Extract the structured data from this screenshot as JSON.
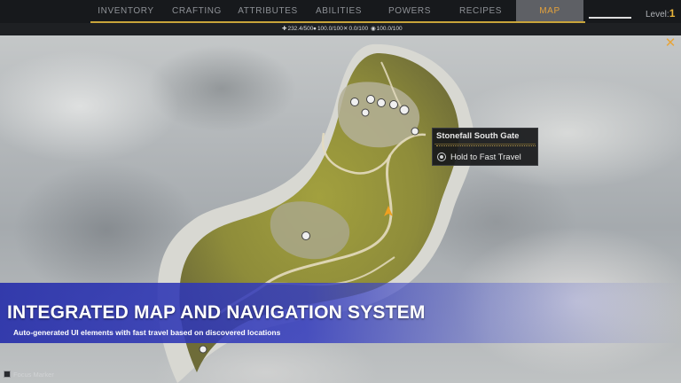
{
  "nav": {
    "tabs": [
      {
        "label": "INVENTORY"
      },
      {
        "label": "CRAFTING"
      },
      {
        "label": "ATTRIBUTES"
      },
      {
        "label": "ABILITIES"
      },
      {
        "label": "POWERS"
      },
      {
        "label": "RECIPES"
      },
      {
        "label": "MAP",
        "active": true
      }
    ],
    "level_label": "Level:",
    "level_value": "1"
  },
  "stats": [
    {
      "icon": "health-icon",
      "value": "232.4/500"
    },
    {
      "icon": "stamina-icon",
      "value": "100.0/100"
    },
    {
      "icon": "weapon-icon",
      "value": "0.0/100"
    },
    {
      "icon": "shield-icon",
      "value": "100.0/100"
    }
  ],
  "tooltip": {
    "title": "Stonefall South Gate",
    "action": "Hold to Fast Travel"
  },
  "banner": {
    "title": "INTEGRATED MAP AND NAVIGATION SYSTEM",
    "subtitle": "Auto-generated UI elements with fast travel based on discovered locations"
  },
  "footer": {
    "focus_marker": "Focus Marker"
  },
  "colors": {
    "accent": "#e3a13b",
    "bar": "#17191c",
    "banner": "#2f38b4"
  }
}
